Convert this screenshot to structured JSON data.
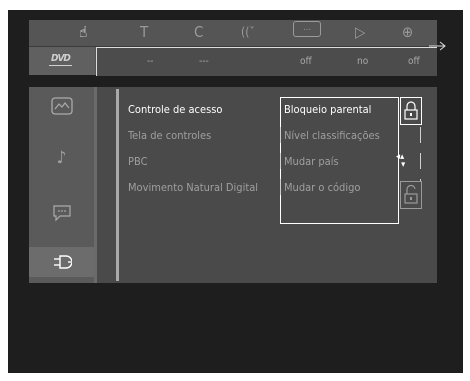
{
  "top_icons": [
    {
      "name": "hand-pointer-icon",
      "glyph": "☝",
      "active": true
    },
    {
      "name": "text-T-icon",
      "glyph": "T",
      "active": false
    },
    {
      "name": "repeat-C-icon",
      "glyph": "C",
      "active": false
    },
    {
      "name": "audio-waves-icon",
      "glyph": "((ˇ",
      "active": false
    },
    {
      "name": "subtitle-bubble-icon",
      "glyph": "…",
      "active": false
    },
    {
      "name": "angle-icon",
      "glyph": "▷",
      "active": false
    },
    {
      "name": "zoom-icon",
      "glyph": "⊕",
      "active": false
    }
  ],
  "values": [
    "--",
    "---",
    "off",
    "no",
    "off"
  ],
  "dvd_label": "DVD",
  "menu": {
    "items": [
      "Controle de acesso",
      "Tela de controles",
      "PBC",
      "Movimento Natural Digital"
    ],
    "selected": 0
  },
  "submenu": {
    "items": [
      "Bloqueio parental",
      "Nível classificações",
      "Mudar país",
      "Mudar o código"
    ],
    "selected": 0
  },
  "sidebar_icons": [
    "picture-icon",
    "music-note-icon",
    "speech-bubble-icon",
    "plug-icon"
  ],
  "colors": {
    "background": "#1e1e1e",
    "panel": "#4a4a4a",
    "topbar": "#555555",
    "highlight": "#ffffff",
    "dim_text": "#9f9f9f"
  }
}
